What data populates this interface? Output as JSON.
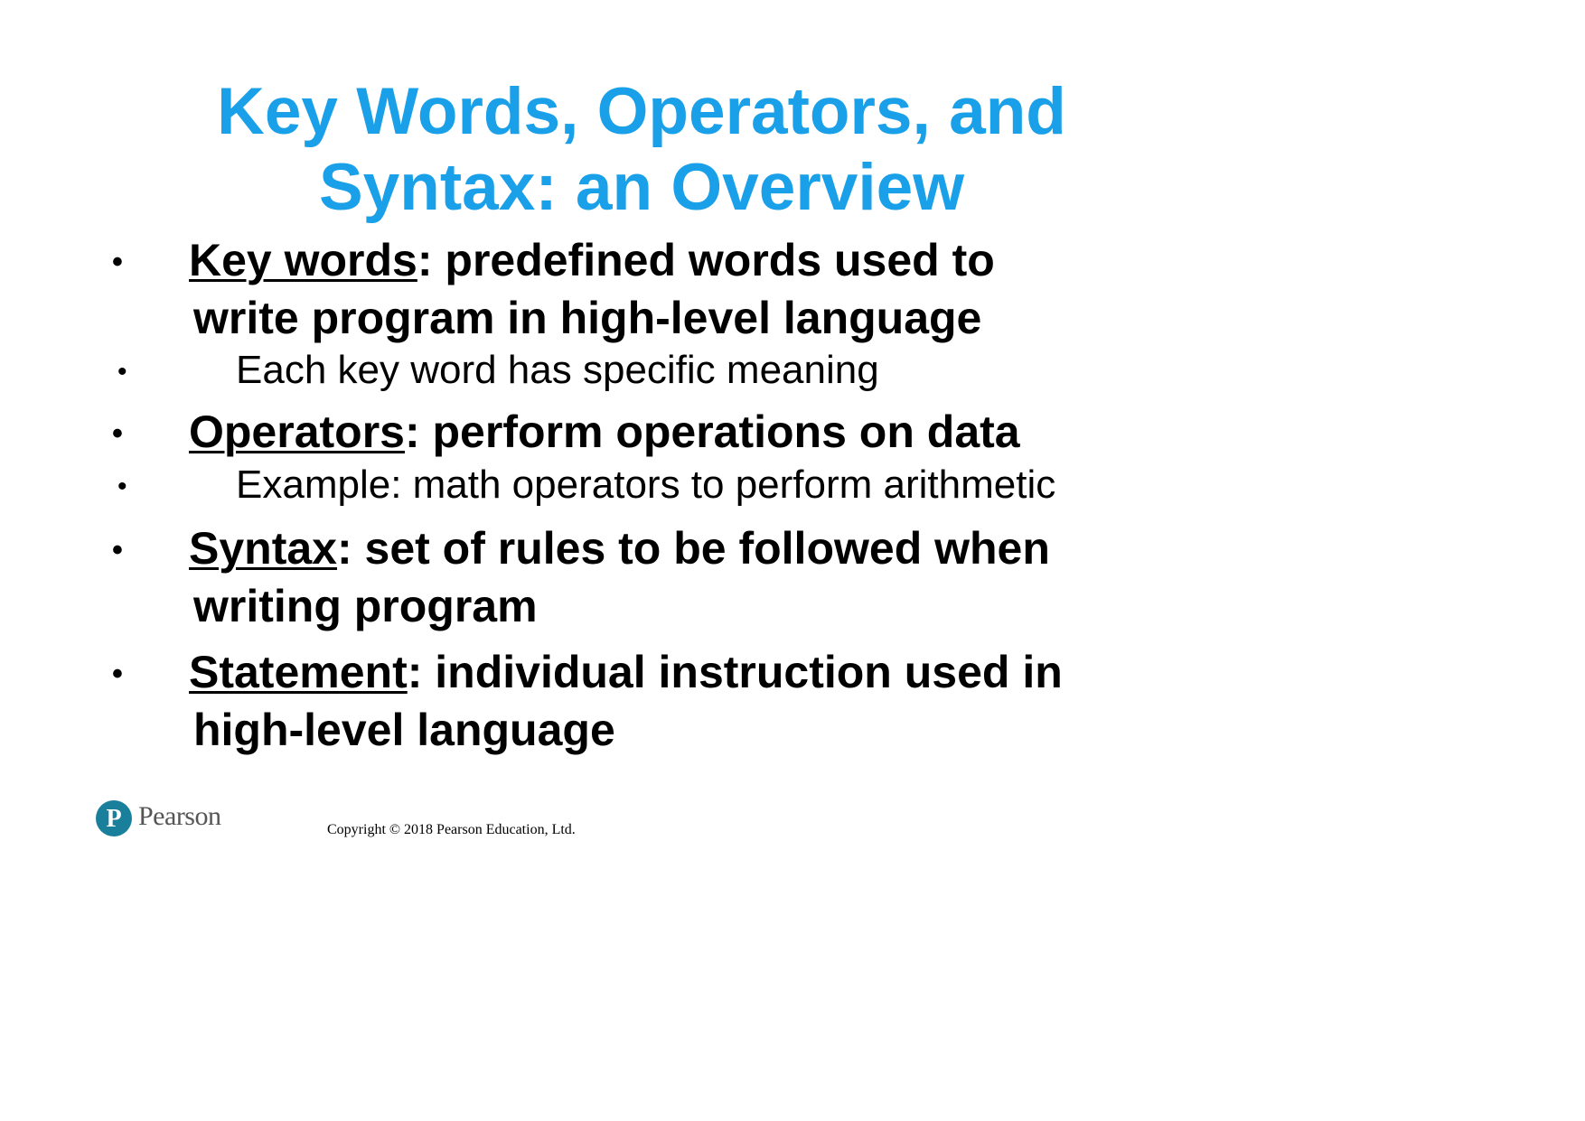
{
  "title": {
    "line1": "Key Words, Operators, and",
    "line2": "Syntax: an Overview",
    "color": "#1aa0e8"
  },
  "bullet_glyph": "•",
  "bullets": [
    {
      "term": "Key words",
      "rest": ": predefined words used to",
      "cont": "write program in high-level language"
    },
    {
      "sub": "Each key word has specific meaning"
    },
    {
      "term": "Operators",
      "rest": ": perform operations on data"
    },
    {
      "sub": "Example: math operators to perform arithmetic"
    },
    {
      "term": "Syntax",
      "rest": ": set of rules to be followed when",
      "cont": "writing program"
    },
    {
      "term": "Statement",
      "rest": ": individual instruction used in",
      "cont": "high-level language"
    }
  ],
  "footer": {
    "logo_icon": "pearson-p-logo-icon",
    "logo_letter": "P",
    "brand": "Pearson",
    "brand_color": "#1a7f9a",
    "copyright": "Copyright © 2018 Pearson Education, Ltd."
  }
}
